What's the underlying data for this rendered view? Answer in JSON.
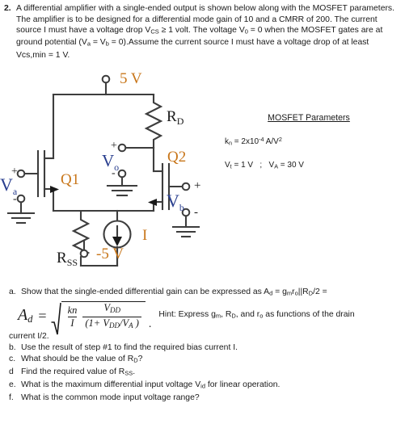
{
  "problem": {
    "number": "2.",
    "text_html": "A differential amplifier with a single-ended output is shown below along with the MOSFET parameters. The amplifier is to be designed for a differential mode gain of 10 and a CMRR of 200. The current source I must have a voltage drop V<sub>CS</sub> &ge; 1 volt. The voltage V<sub>0</sub> = 0 when the  MOSFET gates are at ground potential (V<sub>a</sub> = V<sub>b</sub> = 0).Assume the current source I must have a voltage drop of at least Vcs,min = 1 V.",
    "text_plain": "A differential amplifier with a single-ended output is shown below along with the MOSFET parameters. The amplifier is to be designed for a differential mode gain of 10 and a CMRR of 200. The current source I must have a voltage drop VCS >= 1 volt. The voltage V0 = 0 when the MOSFET gates are at ground potential (Va = Vb = 0).Assume the current source I must have a voltage drop of at least Vcs,min = 1 V."
  },
  "circuit": {
    "supply_positive": "5 V",
    "supply_negative": "-5 V",
    "resistor_drain": "R",
    "resistor_drain_sub": "D",
    "resistor_source": "R",
    "resistor_source_sub": "SS",
    "transistor_left": "Q1",
    "transistor_right": "Q2",
    "current_source": "I",
    "output_label": "V",
    "output_sub": "o",
    "input_left": "V",
    "input_left_sub": "a",
    "input_right": "V",
    "input_right_sub": "b",
    "plus": "+",
    "minus": "-",
    "line_color": "#3d3d3d",
    "label_color": "#c8761a",
    "text_color": "#1a1a1a"
  },
  "mosfet_parameters": {
    "title": "MOSFET Parameters",
    "kn_html": "k<sub>n</sub> = 2x10<sup>-4</sup> A/V<sup>2</sup>",
    "kn_plain": "kn = 2x10-4 A/V2",
    "vt_va_html": "V<sub>t</sub> = 1 V   ;   V<sub>A</sub> = 30 V",
    "vt_va_plain": "Vt = 1 V ; VA = 30 V"
  },
  "subquestions": [
    {
      "label": "a.",
      "text_html": "Show that the single-ended differential gain can be expressed as  A<sub>d</sub> = g<sub>m</sub>r<sub>o</sub>||R<sub>D</sub>/2 ="
    },
    {
      "label": "b.",
      "text_html": "Use the result of step #1 to find the required bias current I."
    },
    {
      "label": "c.",
      "text_html": "What should be the value of R<sub>D</sub>?"
    },
    {
      "label": "d",
      "text_html": "Find the required value of R<sub>SS</sub>."
    },
    {
      "label": "e.",
      "text_html": "What is the maximum differential input voltage V<sub>id</sub> for linear operation."
    },
    {
      "label": "f.",
      "text_html": "What is the common mode input voltage range?"
    }
  ],
  "formula": {
    "lhs": "A",
    "lhs_sub": "d",
    "equals": "=",
    "frac1_num": "kn",
    "frac1_den": "I",
    "frac2_num_html": "V<sub>DD</sub>",
    "frac2_den_html": "(1+ V<sub>DD</sub>/V<sub>A</sub> )",
    "period": ".",
    "hint_html": "Hint: Express g<sub>m</sub>, R<sub>D</sub>, and r<sub>o</sub> as functions of the drain",
    "tail": "current  I/2."
  }
}
